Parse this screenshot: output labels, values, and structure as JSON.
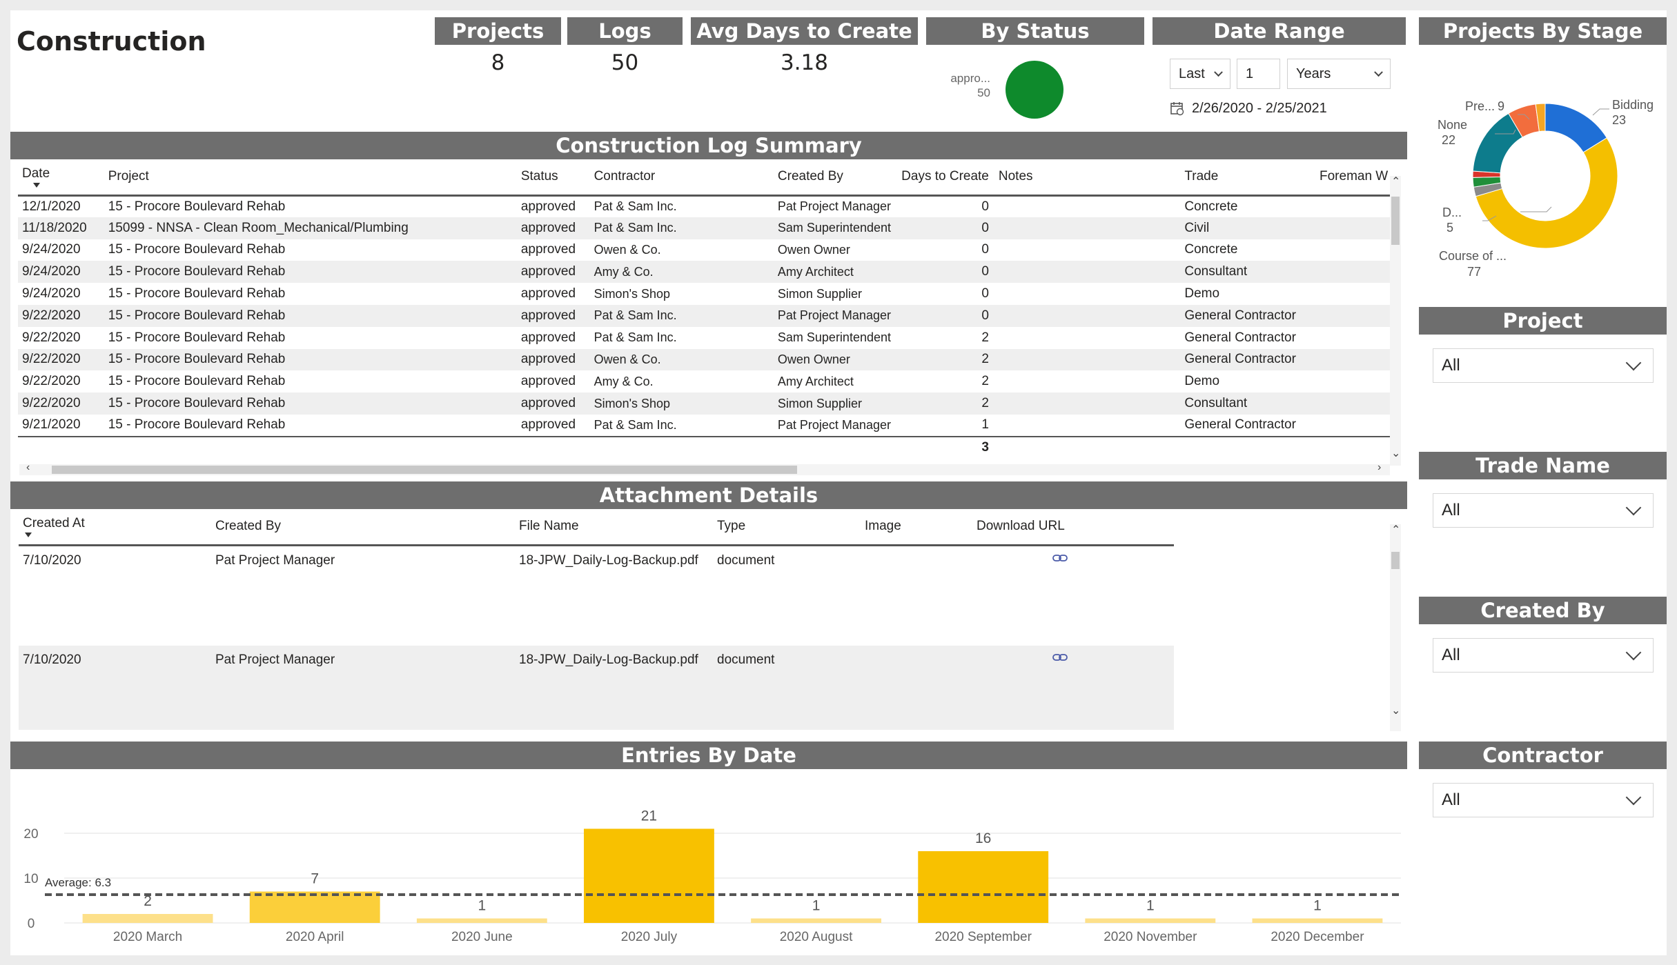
{
  "title": "Construction",
  "kpis": {
    "projects": {
      "label": "Projects",
      "value": "8"
    },
    "logs": {
      "label": "Logs",
      "value": "50"
    },
    "avg_days": {
      "label": "Avg Days to Create",
      "value": "3.18"
    }
  },
  "by_status": {
    "label": "By Status",
    "slice_label": "appro...",
    "slice_value": "50",
    "color": "#0e8a2c"
  },
  "date_range": {
    "label": "Date Range",
    "mode": "Last",
    "count": "1",
    "unit": "Years",
    "range_text": "2/26/2020 - 2/25/2021"
  },
  "stage_donut": {
    "label": "Projects By Stage",
    "labels": [
      {
        "name": "Bidding",
        "value": "23"
      },
      {
        "name": "Course of ...",
        "value": "77"
      },
      {
        "name": "D...",
        "value": "5"
      },
      {
        "name": "None",
        "value": "22"
      },
      {
        "name": "Pre...",
        "value": "9"
      }
    ],
    "slices": [
      {
        "value": 23,
        "color": "#1f6fd6"
      },
      {
        "value": 77,
        "color": "#f4bf00"
      },
      {
        "value": 3,
        "color": "#8a8a8a"
      },
      {
        "value": 3,
        "color": "#1f8f3a"
      },
      {
        "value": 2,
        "color": "#d9342b"
      },
      {
        "value": 22,
        "color": "#0d7c8c"
      },
      {
        "value": 9,
        "color": "#f26d3d"
      },
      {
        "value": 3,
        "color": "#f5a623"
      }
    ]
  },
  "log_summary": {
    "label": "Construction Log Summary",
    "columns": [
      "Date",
      "Project",
      "Status",
      "Contractor",
      "Created By",
      "Days to Create",
      "Notes",
      "Trade",
      "Foreman W"
    ],
    "rows": [
      [
        "12/1/2020",
        "15 - Procore Boulevard Rehab",
        "approved",
        "Pat & Sam Inc.",
        "Pat Project Manager",
        "0",
        "",
        "Concrete",
        ""
      ],
      [
        "11/18/2020",
        "15099 - NNSA - Clean Room_Mechanical/Plumbing",
        "approved",
        "Pat & Sam Inc.",
        "Sam Superintendent",
        "0",
        "",
        "Civil",
        ""
      ],
      [
        "9/24/2020",
        "15 - Procore Boulevard Rehab",
        "approved",
        "Owen & Co.",
        "Owen Owner",
        "0",
        "",
        "Concrete",
        ""
      ],
      [
        "9/24/2020",
        "15 - Procore Boulevard Rehab",
        "approved",
        "Amy & Co.",
        "Amy Architect",
        "0",
        "",
        "Consultant",
        ""
      ],
      [
        "9/24/2020",
        "15 - Procore Boulevard Rehab",
        "approved",
        "Simon's Shop",
        "Simon Supplier",
        "0",
        "",
        "Demo",
        ""
      ],
      [
        "9/22/2020",
        "15 - Procore Boulevard Rehab",
        "approved",
        "Pat & Sam Inc.",
        "Pat Project Manager",
        "0",
        "",
        "General Contractor",
        ""
      ],
      [
        "9/22/2020",
        "15 - Procore Boulevard Rehab",
        "approved",
        "Pat & Sam Inc.",
        "Sam Superintendent",
        "2",
        "",
        "General Contractor",
        ""
      ],
      [
        "9/22/2020",
        "15 - Procore Boulevard Rehab",
        "approved",
        "Owen & Co.",
        "Owen Owner",
        "2",
        "",
        "General Contractor",
        ""
      ],
      [
        "9/22/2020",
        "15 - Procore Boulevard Rehab",
        "approved",
        "Amy & Co.",
        "Amy Architect",
        "2",
        "",
        "Demo",
        ""
      ],
      [
        "9/22/2020",
        "15 - Procore Boulevard Rehab",
        "approved",
        "Simon's Shop",
        "Simon Supplier",
        "2",
        "",
        "Consultant",
        ""
      ],
      [
        "9/21/2020",
        "15 - Procore Boulevard Rehab",
        "approved",
        "Pat & Sam Inc.",
        "Pat Project Manager",
        "1",
        "",
        "General Contractor",
        ""
      ]
    ],
    "total_days": "3"
  },
  "attachments": {
    "label": "Attachment Details",
    "columns": [
      "Created At",
      "Created By",
      "File Name",
      "Type",
      "Image",
      "Download URL"
    ],
    "rows": [
      [
        "7/10/2020",
        "Pat Project Manager",
        "18-JPW_Daily-Log-Backup.pdf",
        "document"
      ],
      [
        "7/10/2020",
        "Pat Project Manager",
        "18-JPW_Daily-Log-Backup.pdf",
        "document"
      ]
    ]
  },
  "slicers": {
    "project": {
      "label": "Project",
      "value": "All"
    },
    "trade": {
      "label": "Trade Name",
      "value": "All"
    },
    "created_by": {
      "label": "Created By",
      "value": "All"
    },
    "contractor": {
      "label": "Contractor",
      "value": "All"
    }
  },
  "chart_data": {
    "type": "bar",
    "title": "Entries By Date",
    "categories": [
      "2020 March",
      "2020 April",
      "2020 June",
      "2020 July",
      "2020 August",
      "2020 September",
      "2020 November",
      "2020 December"
    ],
    "values": [
      2,
      7,
      1,
      21,
      1,
      16,
      1,
      1
    ],
    "ylim": [
      0,
      20
    ],
    "yticks": [
      0,
      10,
      20
    ],
    "average": 6.3,
    "average_label": "Average: 6.3",
    "colors": {
      "high": "#f8c100",
      "mid": "#fbcf3a",
      "low": "#fde08a"
    }
  }
}
